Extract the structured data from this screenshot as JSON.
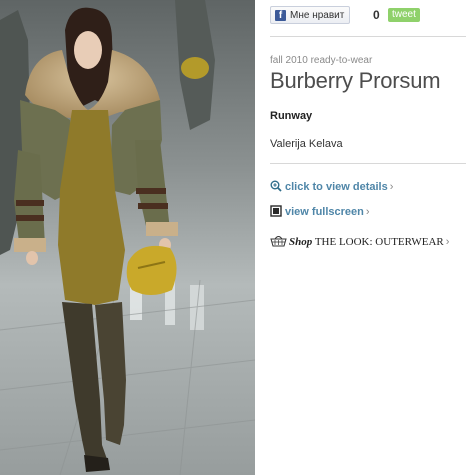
{
  "social": {
    "like_label": "Мне нравит",
    "fb_glyph": "f",
    "count": "0",
    "tweet_label": "tweet"
  },
  "collection": {
    "season": "fall 2010 ready-to-wear",
    "designer": "Burberry Prorsum"
  },
  "section": "Runway",
  "model_name": "Valerija Kelava",
  "links": {
    "details": {
      "label": "click to view details",
      "chevron": "›",
      "icon": "magnifier-plus-icon"
    },
    "fullscreen": {
      "label": "view fullscreen",
      "chevron": "›",
      "icon": "fullscreen-icon"
    },
    "shop": {
      "shop_word": "Shop",
      "look_label": "THE LOOK: OUTERWEAR",
      "chevron": "›",
      "icon": "shopping-basket-icon"
    }
  },
  "colors": {
    "link": "#4f86a8",
    "tweet_bg": "#8fd16b",
    "facebook": "#3b5998",
    "title": "#4d4d4d"
  }
}
